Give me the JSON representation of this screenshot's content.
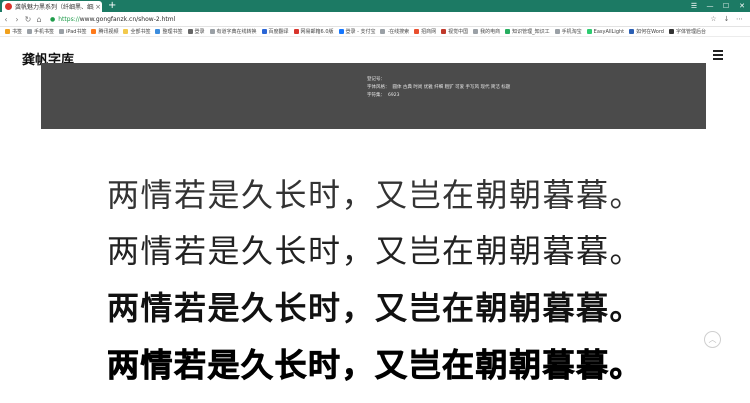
{
  "browser": {
    "tab_title": "龚帆魅力黑系列（纤细黑、细黑、",
    "tab_close": "×",
    "new_tab": "+",
    "url_scheme": "https://",
    "url_rest": "www.gongfanzk.cn/show-2.html",
    "nav": {
      "back": "‹",
      "forward": "›",
      "reload": "↻",
      "home": "⌂"
    },
    "window_controls": [
      "☰",
      "—",
      "☐",
      "✕"
    ],
    "bookmarks": [
      "书签",
      "手机书签",
      "iPad书签",
      "腾讯视频",
      "全部书签",
      "整理书签",
      "登录",
      "有道字典在线转换",
      "百度翻译",
      "网易邮箱6.0版",
      "登录 - 支付宝",
      "·在线搜索",
      "招商网",
      "视觉中国",
      "我的电商",
      "知识管理_知识工",
      "手机淘宝",
      "EasyAllLight",
      "如何在Word",
      "字体管理后台"
    ]
  },
  "page": {
    "logo": "龚帆字库",
    "info": {
      "reg_label": "登记号：",
      "reg_value": "",
      "style_label": "字体风格：",
      "style_value": "圆体 古典 时尚 优雅 纤细 粗犷 可爱 手写风 现代 简洁 标题",
      "count_label": "字符集：",
      "count_value": "6923"
    },
    "sample_lines": [
      "两情若是久长时，又岂在朝朝暮暮。",
      "两情若是久长时，又岂在朝朝暮暮。",
      "两情若是久长时，又岂在朝朝暮暮。",
      "两情若是久长时，又岂在朝朝暮暮。"
    ],
    "back_to_top": "︿"
  }
}
